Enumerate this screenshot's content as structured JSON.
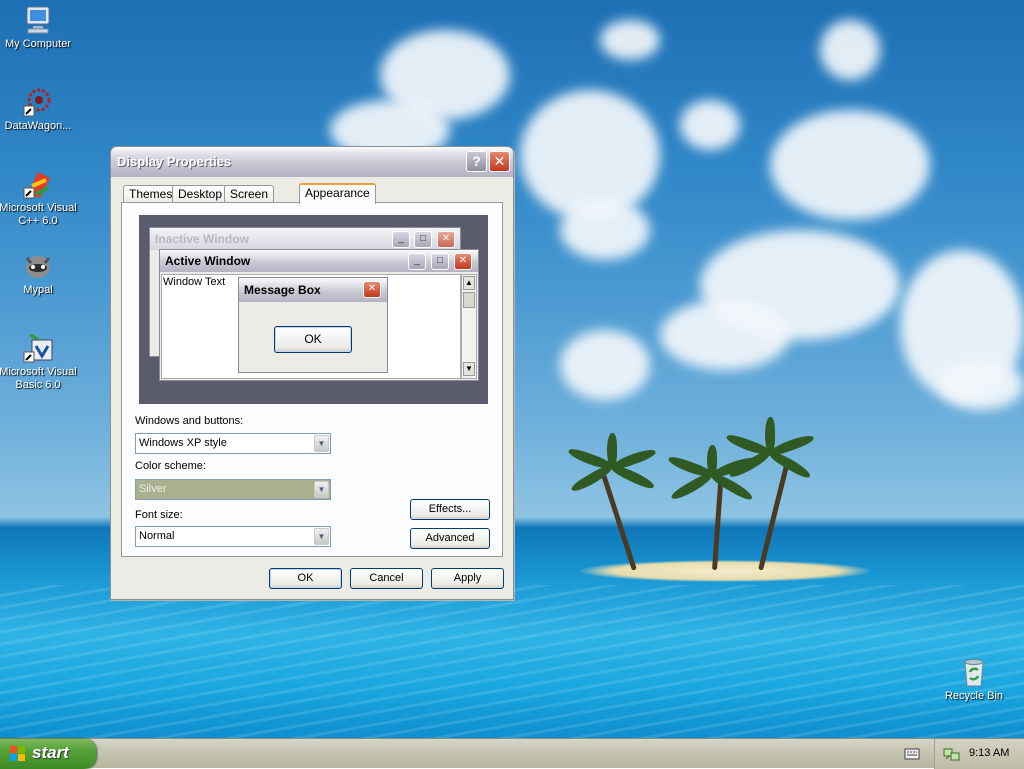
{
  "desktop": {
    "icons": [
      {
        "label": "My Computer",
        "icon": "my-computer-icon"
      },
      {
        "label": "DataWagon...",
        "icon": "datawagon-icon"
      },
      {
        "label": "Microsoft Visual C++ 6.0",
        "icon": "visual-cpp-icon"
      },
      {
        "label": "Mypal",
        "icon": "mypal-icon"
      },
      {
        "label": "Microsoft Visual Basic 6.0",
        "icon": "visual-basic-icon"
      },
      {
        "label": "Recycle Bin",
        "icon": "recycle-bin-icon"
      }
    ]
  },
  "dialog": {
    "title": "Display Properties",
    "help_glyph": "?",
    "close_glyph": "✕",
    "tabs": [
      {
        "label": "Themes",
        "active": false
      },
      {
        "label": "Desktop",
        "active": false
      },
      {
        "label": "Screen Saver",
        "active": false
      },
      {
        "label": "Appearance",
        "active": true
      }
    ],
    "preview": {
      "inactive_title": "Inactive Window",
      "active_title": "Active Window",
      "window_text": "Window Text",
      "message_box_title": "Message Box",
      "message_box_ok": "OK"
    },
    "windows_buttons": {
      "label": "Windows and buttons:",
      "value": "Windows XP style"
    },
    "color_scheme": {
      "label": "Color scheme:",
      "value": "Silver"
    },
    "font_size": {
      "label": "Font size:",
      "value": "Normal"
    },
    "effects_label": "Effects...",
    "advanced_label": "Advanced",
    "ok_label": "OK",
    "cancel_label": "Cancel",
    "apply_label": "Apply"
  },
  "taskbar": {
    "start_label": "start",
    "clock": "9:13 AM"
  },
  "colors": {
    "title_silver": "#c6c6d3",
    "start_green": "#58a43a",
    "accent_orange": "#e9a23b"
  }
}
